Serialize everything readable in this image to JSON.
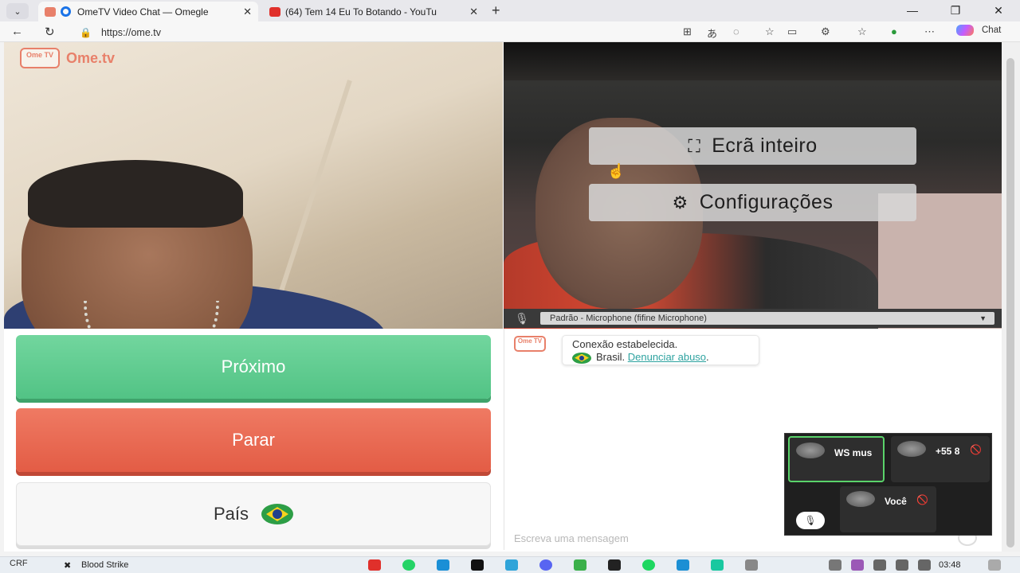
{
  "browser": {
    "tabs": [
      {
        "title": "OmeTV Video Chat — Omegle",
        "active": true
      },
      {
        "title": "(64) Tem 14 Eu To Botando - YouTu",
        "active": false
      }
    ],
    "url": "https://ome.tv",
    "chat_button": "Chat",
    "window_controls": {
      "minimize": "—",
      "restore": "❐",
      "close": "✕"
    }
  },
  "page": {
    "logo_text": "Ome.tv",
    "logo_badge": "Ome TV",
    "overlay_menu": {
      "fullscreen": "Ecrã inteiro",
      "settings": "Configurações"
    },
    "microphone_select": "Padrão - Microphone (fifine Microphone)",
    "buttons": {
      "next": "Próximo",
      "stop": "Parar",
      "country": "País"
    },
    "chat": {
      "system_message_line1": "Conexão estabelecida.",
      "country_name": "Brasil.",
      "report_link": "Denunciar abuso",
      "report_suffix": ".",
      "input_placeholder": "Escreva uma mensagem"
    }
  },
  "call_panel": {
    "participants": [
      {
        "name": "WS mus",
        "speaking": true
      },
      {
        "name": "+55 8",
        "muted": true
      },
      {
        "name": "Você",
        "muted": true
      }
    ]
  },
  "taskbar": {
    "weather": "CRF",
    "app_label": "Blood Strike",
    "time": "03:48"
  },
  "colors": {
    "next_green": "#52c385",
    "stop_red": "#e35c45",
    "brand_coral": "#e8806a",
    "link_teal": "#2ea3a0"
  }
}
